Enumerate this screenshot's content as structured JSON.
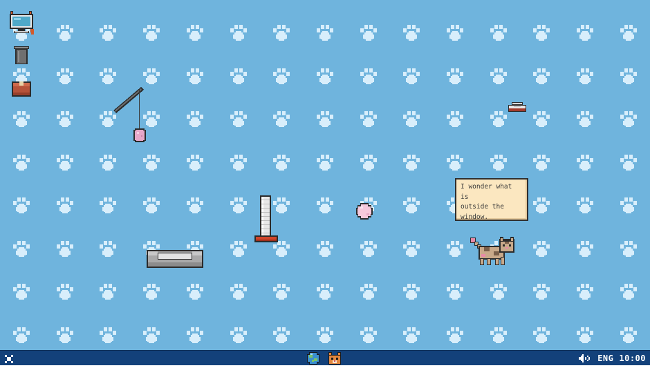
{
  "desktop": {
    "background_color": "#6fb4dd",
    "pattern": "paw-print",
    "pattern_color": "#d8eefb",
    "icons": [
      {
        "name": "computer-cat-icon"
      },
      {
        "name": "trash-bin-icon"
      },
      {
        "name": "cardboard-box-icon"
      }
    ],
    "objects": [
      {
        "name": "feather-wand-toy"
      },
      {
        "name": "food-bowl"
      },
      {
        "name": "scratching-post"
      },
      {
        "name": "yarn-ball"
      },
      {
        "name": "cat-bed"
      },
      {
        "name": "pet-cat"
      }
    ]
  },
  "speech_bubble": {
    "text": "I wonder what is\noutside the\nwindow."
  },
  "taskbar": {
    "background_color": "#13417a",
    "start_icon": "close-x-icon",
    "apps": [
      {
        "name": "globe-browser-icon"
      },
      {
        "name": "cat-face-app-icon"
      }
    ],
    "tray": {
      "volume_icon": "speaker-icon",
      "language": "ENG",
      "time": "10:00"
    }
  }
}
